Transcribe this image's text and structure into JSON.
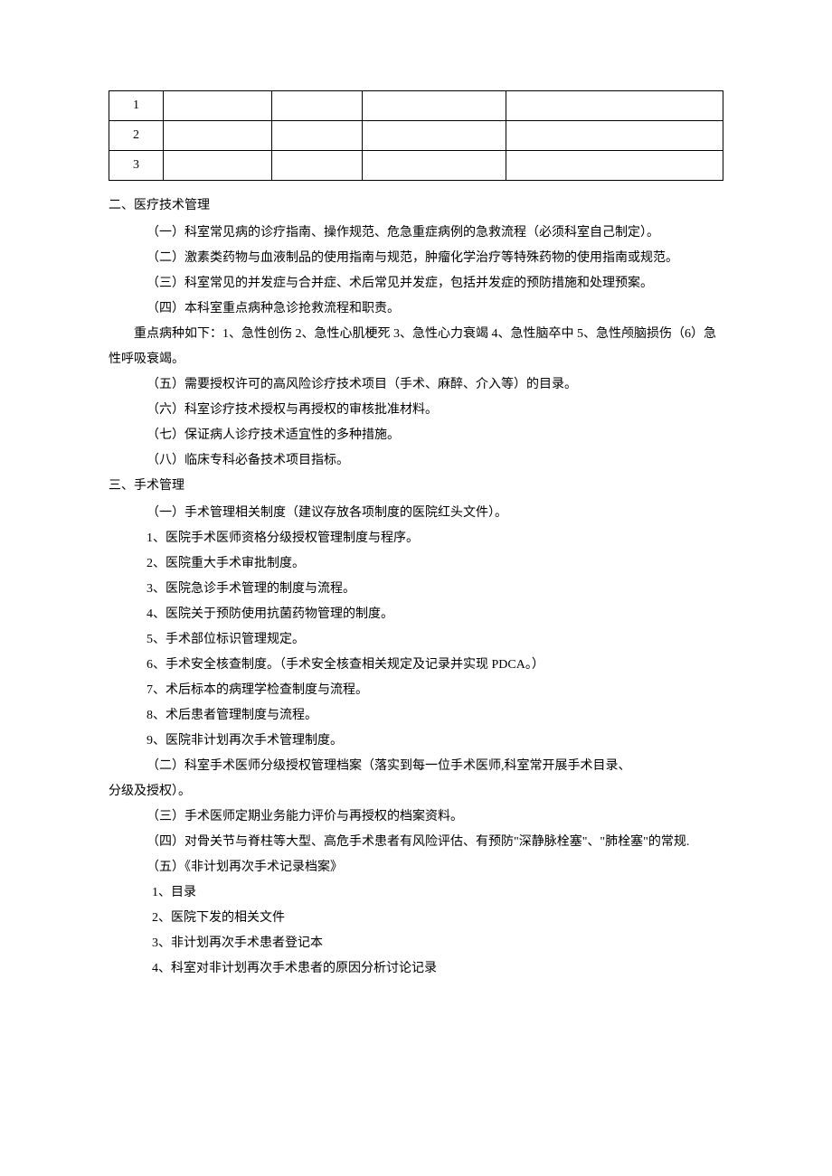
{
  "table": {
    "rows": [
      "1",
      "2",
      "3"
    ]
  },
  "sec2": {
    "title": "二、医疗技术管理",
    "i1": "（一）科室常见病的诊疗指南、操作规范、危急重症病例的急救流程（必须科室自己制定）。",
    "i2": "（二）激素类药物与血液制品的使用指南与规范，肿瘤化学治疗等特殊药物的使用指南或规范。",
    "i3": "（三）科室常见的并发症与合并症、术后常见并发症，包括并发症的预防措施和处理预案。",
    "i4": "（四）本科室重点病种急诊抢救流程和职责。",
    "i4b": "重点病种如下：1、急性创伤 2、急性心肌梗死 3、急性心力衰竭 4、急性脑卒中 5、急性颅脑损伤（6）急性呼吸衰竭。",
    "i5": "（五）需要授权许可的高风险诊疗技术项目（手术、麻醉、介入等）的目录。",
    "i6": "（六）科室诊疗技术授权与再授权的审核批准材料。",
    "i7": "（七）保证病人诊疗技术适宜性的多种措施。",
    "i8": "（八）临床专科必备技术项目指标。"
  },
  "sec3": {
    "title": "三、手术管理",
    "a1": "（一）手术管理相关制度（建议存放各项制度的医院红头文件）。",
    "a1_1": "1、医院手术医师资格分级授权管理制度与程序。",
    "a1_2": "2、医院重大手术审批制度。",
    "a1_3": "3、医院急诊手术管理的制度与流程。",
    "a1_4": "4、医院关于预防使用抗菌药物管理的制度。",
    "a1_5": "5、手术部位标识管理规定。",
    "a1_6": "6、手术安全核查制度。（手术安全核查相关规定及记录并实现 PDCA。）",
    "a1_7": "7、术后标本的病理学检查制度与流程。",
    "a1_8": "8、术后患者管理制度与流程。",
    "a1_9": "9、医院非计划再次手术管理制度。",
    "a2": "（二）科室手术医师分级授权管理档案（落实到每一位手术医师,科室常开展手术目录、",
    "a2b": "分级及授权）。",
    "a3": "（三）手术医师定期业务能力评价与再授权的档案资料。",
    "a4": "（四）对骨关节与脊柱等大型、高危手术患者有风险评估、有预防\"深静脉栓塞\"、\"肺栓塞\"的常规.",
    "a5": "（五）《非计划再次手术记录档案》",
    "a5_1": "1、目录",
    "a5_2": "2、医院下发的相关文件",
    "a5_3": "3、非计划再次手术患者登记本",
    "a5_4": "4、科室对非计划再次手术患者的原因分析讨论记录"
  }
}
